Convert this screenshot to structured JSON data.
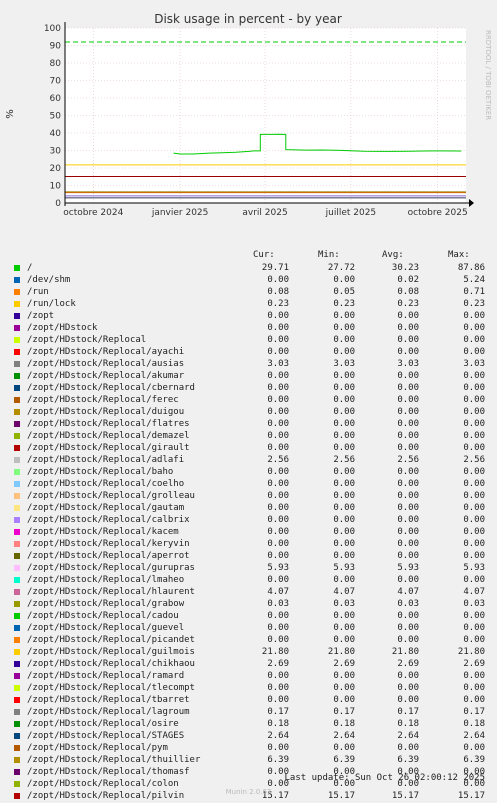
{
  "chart_data": {
    "type": "line",
    "title": "Disk usage in percent - by year",
    "ylabel": "%",
    "side_text": "RRDTOOL / TOBI OETIKER",
    "ylim": [
      0,
      100
    ],
    "yticks": [
      0,
      10,
      20,
      30,
      40,
      50,
      60,
      70,
      80,
      90,
      100
    ],
    "xticks": [
      "octobre 2024",
      "janvier 2025",
      "avril 2025",
      "juillet 2025",
      "octobre 2025"
    ],
    "grid": true,
    "root_series": {
      "name": "/",
      "color": "#00cc00",
      "x": [
        "2024-12-25",
        "2025-01-01",
        "2025-01-15",
        "2025-02-01",
        "2025-02-15",
        "2025-03-01",
        "2025-03-15",
        "2025-03-20",
        "2025-03-27",
        "2025-04-10",
        "2025-04-15",
        "2025-04-22",
        "2025-04-23",
        "2025-05-15",
        "2025-06-01",
        "2025-06-20",
        "2025-07-15",
        "2025-08-01",
        "2025-08-15",
        "2025-09-01",
        "2025-09-15",
        "2025-10-01",
        "2025-10-26"
      ],
      "y": [
        28.5,
        28.0,
        28.0,
        28.5,
        28.7,
        29.0,
        29.5,
        29.8,
        39.2,
        39.2,
        39.3,
        39.2,
        30.5,
        30.2,
        30.3,
        30.1,
        29.6,
        29.5,
        29.5,
        29.6,
        29.7,
        29.8,
        29.71
      ]
    },
    "max_line": {
      "name": "/ max",
      "value": 92.0,
      "color": "#00cc00"
    },
    "flat_lines": [
      {
        "label": "/zopt/HDstock/Replocal/guilmois",
        "value": 21.8,
        "color": "#ffcc00"
      },
      {
        "label": "/zopt/HDstock/Replocal/pilvin",
        "value": 15.17,
        "color": "#990000"
      },
      {
        "label": "/zopt/HDstock/Replocal/thuillier",
        "value": 6.39,
        "color": "#a08000"
      },
      {
        "label": "/zopt/HDstock/Replocal/gurupras",
        "value": 5.93,
        "color": "#cc6600"
      },
      {
        "label": "/zopt/HDstock/Replocal/hlaurent",
        "value": 4.07,
        "color": "#8a6ecc"
      },
      {
        "label": "/zopt/HDstock/Replocal/ausias",
        "value": 3.03,
        "color": "#777777"
      },
      {
        "label": "/zopt/HDstock/Replocal/chikhaou",
        "value": 2.69,
        "color": "#330099"
      },
      {
        "label": "/zopt/HDstock/Replocal/STAGES",
        "value": 2.64,
        "color": "#00589c"
      },
      {
        "label": "/zopt/HDstock/Replocal/adlafi",
        "value": 2.56,
        "color": "#bbbbbb"
      }
    ],
    "legend_headers": {
      "cur": "Cur:",
      "min": "Min:",
      "avg": "Avg:",
      "max": "Max:"
    },
    "legend": [
      {
        "name": "/",
        "color": "#00cc00",
        "cur": "29.71",
        "min": "27.72",
        "avg": "30.23",
        "max": "87.86"
      },
      {
        "name": "/dev/shm",
        "color": "#0066b3",
        "cur": "0.00",
        "min": "0.00",
        "avg": "0.02",
        "max": "5.24"
      },
      {
        "name": "/run",
        "color": "#ff8000",
        "cur": "0.08",
        "min": "0.05",
        "avg": "0.08",
        "max": "0.71"
      },
      {
        "name": "/run/lock",
        "color": "#ffcc00",
        "cur": "0.23",
        "min": "0.23",
        "avg": "0.23",
        "max": "0.23"
      },
      {
        "name": "/zopt",
        "color": "#330099",
        "cur": "0.00",
        "min": "0.00",
        "avg": "0.00",
        "max": "0.00"
      },
      {
        "name": "/zopt/HDstock",
        "color": "#990099",
        "cur": "0.00",
        "min": "0.00",
        "avg": "0.00",
        "max": "0.00"
      },
      {
        "name": "/zopt/HDstock/Replocal",
        "color": "#ccff00",
        "cur": "0.00",
        "min": "0.00",
        "avg": "0.00",
        "max": "0.00"
      },
      {
        "name": "/zopt/HDstock/Replocal/ayachi",
        "color": "#ff0000",
        "cur": "0.00",
        "min": "0.00",
        "avg": "0.00",
        "max": "0.00"
      },
      {
        "name": "/zopt/HDstock/Replocal/ausias",
        "color": "#808080",
        "cur": "3.03",
        "min": "3.03",
        "avg": "3.03",
        "max": "3.03"
      },
      {
        "name": "/zopt/HDstock/Replocal/akumar",
        "color": "#008f00",
        "cur": "0.00",
        "min": "0.00",
        "avg": "0.00",
        "max": "0.00"
      },
      {
        "name": "/zopt/HDstock/Replocal/cbernard",
        "color": "#00487d",
        "cur": "0.00",
        "min": "0.00",
        "avg": "0.00",
        "max": "0.00"
      },
      {
        "name": "/zopt/HDstock/Replocal/ferec",
        "color": "#b35a00",
        "cur": "0.00",
        "min": "0.00",
        "avg": "0.00",
        "max": "0.00"
      },
      {
        "name": "/zopt/HDstock/Replocal/duigou",
        "color": "#b38f00",
        "cur": "0.00",
        "min": "0.00",
        "avg": "0.00",
        "max": "0.00"
      },
      {
        "name": "/zopt/HDstock/Replocal/flatres",
        "color": "#6b006b",
        "cur": "0.00",
        "min": "0.00",
        "avg": "0.00",
        "max": "0.00"
      },
      {
        "name": "/zopt/HDstock/Replocal/demazel",
        "color": "#8fb300",
        "cur": "0.00",
        "min": "0.00",
        "avg": "0.00",
        "max": "0.00"
      },
      {
        "name": "/zopt/HDstock/Replocal/girault",
        "color": "#b30000",
        "cur": "0.00",
        "min": "0.00",
        "avg": "0.00",
        "max": "0.00"
      },
      {
        "name": "/zopt/HDstock/Replocal/adlafi",
        "color": "#bebebe",
        "cur": "2.56",
        "min": "2.56",
        "avg": "2.56",
        "max": "2.56"
      },
      {
        "name": "/zopt/HDstock/Replocal/baho",
        "color": "#80ff80",
        "cur": "0.00",
        "min": "0.00",
        "avg": "0.00",
        "max": "0.00"
      },
      {
        "name": "/zopt/HDstock/Replocal/coelho",
        "color": "#80c9ff",
        "cur": "0.00",
        "min": "0.00",
        "avg": "0.00",
        "max": "0.00"
      },
      {
        "name": "/zopt/HDstock/Replocal/grolleau",
        "color": "#ffc080",
        "cur": "0.00",
        "min": "0.00",
        "avg": "0.00",
        "max": "0.00"
      },
      {
        "name": "/zopt/HDstock/Replocal/gautam",
        "color": "#ffe680",
        "cur": "0.00",
        "min": "0.00",
        "avg": "0.00",
        "max": "0.00"
      },
      {
        "name": "/zopt/HDstock/Replocal/calbrix",
        "color": "#aa80ff",
        "cur": "0.00",
        "min": "0.00",
        "avg": "0.00",
        "max": "0.00"
      },
      {
        "name": "/zopt/HDstock/Replocal/kacem",
        "color": "#ee00cc",
        "cur": "0.00",
        "min": "0.00",
        "avg": "0.00",
        "max": "0.00"
      },
      {
        "name": "/zopt/HDstock/Replocal/keryvin",
        "color": "#ff8080",
        "cur": "0.00",
        "min": "0.00",
        "avg": "0.00",
        "max": "0.00"
      },
      {
        "name": "/zopt/HDstock/Replocal/aperrot",
        "color": "#666600",
        "cur": "0.00",
        "min": "0.00",
        "avg": "0.00",
        "max": "0.00"
      },
      {
        "name": "/zopt/HDstock/Replocal/gurupras",
        "color": "#ffbfff",
        "cur": "5.93",
        "min": "5.93",
        "avg": "5.93",
        "max": "5.93"
      },
      {
        "name": "/zopt/HDstock/Replocal/lmaheo",
        "color": "#00ffcc",
        "cur": "0.00",
        "min": "0.00",
        "avg": "0.00",
        "max": "0.00"
      },
      {
        "name": "/zopt/HDstock/Replocal/hlaurent",
        "color": "#cc6699",
        "cur": "4.07",
        "min": "4.07",
        "avg": "4.07",
        "max": "4.07"
      },
      {
        "name": "/zopt/HDstock/Replocal/grabow",
        "color": "#999900",
        "cur": "0.03",
        "min": "0.03",
        "avg": "0.03",
        "max": "0.03"
      },
      {
        "name": "/zopt/HDstock/Replocal/cadou",
        "color": "#00cc00",
        "cur": "0.00",
        "min": "0.00",
        "avg": "0.00",
        "max": "0.00"
      },
      {
        "name": "/zopt/HDstock/Replocal/guevel",
        "color": "#0066b3",
        "cur": "0.00",
        "min": "0.00",
        "avg": "0.00",
        "max": "0.00"
      },
      {
        "name": "/zopt/HDstock/Replocal/picandet",
        "color": "#ff8000",
        "cur": "0.00",
        "min": "0.00",
        "avg": "0.00",
        "max": "0.00"
      },
      {
        "name": "/zopt/HDstock/Replocal/guilmois",
        "color": "#ffcc00",
        "cur": "21.80",
        "min": "21.80",
        "avg": "21.80",
        "max": "21.80"
      },
      {
        "name": "/zopt/HDstock/Replocal/chikhaou",
        "color": "#330099",
        "cur": "2.69",
        "min": "2.69",
        "avg": "2.69",
        "max": "2.69"
      },
      {
        "name": "/zopt/HDstock/Replocal/ramard",
        "color": "#990099",
        "cur": "0.00",
        "min": "0.00",
        "avg": "0.00",
        "max": "0.00"
      },
      {
        "name": "/zopt/HDstock/Replocal/tlecompt",
        "color": "#ccff00",
        "cur": "0.00",
        "min": "0.00",
        "avg": "0.00",
        "max": "0.00"
      },
      {
        "name": "/zopt/HDstock/Replocal/tbarret",
        "color": "#ff0000",
        "cur": "0.00",
        "min": "0.00",
        "avg": "0.00",
        "max": "0.00"
      },
      {
        "name": "/zopt/HDstock/Replocal/lagroum",
        "color": "#808080",
        "cur": "0.17",
        "min": "0.17",
        "avg": "0.17",
        "max": "0.17"
      },
      {
        "name": "/zopt/HDstock/Replocal/osire",
        "color": "#008f00",
        "cur": "0.18",
        "min": "0.18",
        "avg": "0.18",
        "max": "0.18"
      },
      {
        "name": "/zopt/HDstock/Replocal/STAGES",
        "color": "#00487d",
        "cur": "2.64",
        "min": "2.64",
        "avg": "2.64",
        "max": "2.64"
      },
      {
        "name": "/zopt/HDstock/Replocal/pym",
        "color": "#b35a00",
        "cur": "0.00",
        "min": "0.00",
        "avg": "0.00",
        "max": "0.00"
      },
      {
        "name": "/zopt/HDstock/Replocal/thuillier",
        "color": "#b38f00",
        "cur": "6.39",
        "min": "6.39",
        "avg": "6.39",
        "max": "6.39"
      },
      {
        "name": "/zopt/HDstock/Replocal/thomasf",
        "color": "#6b006b",
        "cur": "0.00",
        "min": "0.00",
        "avg": "0.00",
        "max": "0.00"
      },
      {
        "name": "/zopt/HDstock/Replocal/colon",
        "color": "#8fb300",
        "cur": "0.00",
        "min": "0.00",
        "avg": "0.00",
        "max": "0.00"
      },
      {
        "name": "/zopt/HDstock/Replocal/pilvin",
        "color": "#b30000",
        "cur": "15.17",
        "min": "15.17",
        "avg": "15.17",
        "max": "15.17"
      }
    ]
  },
  "last_update": "Last update: Sun Oct 26 02:00:12 2025",
  "munin_version": "Munin 2.0.67"
}
